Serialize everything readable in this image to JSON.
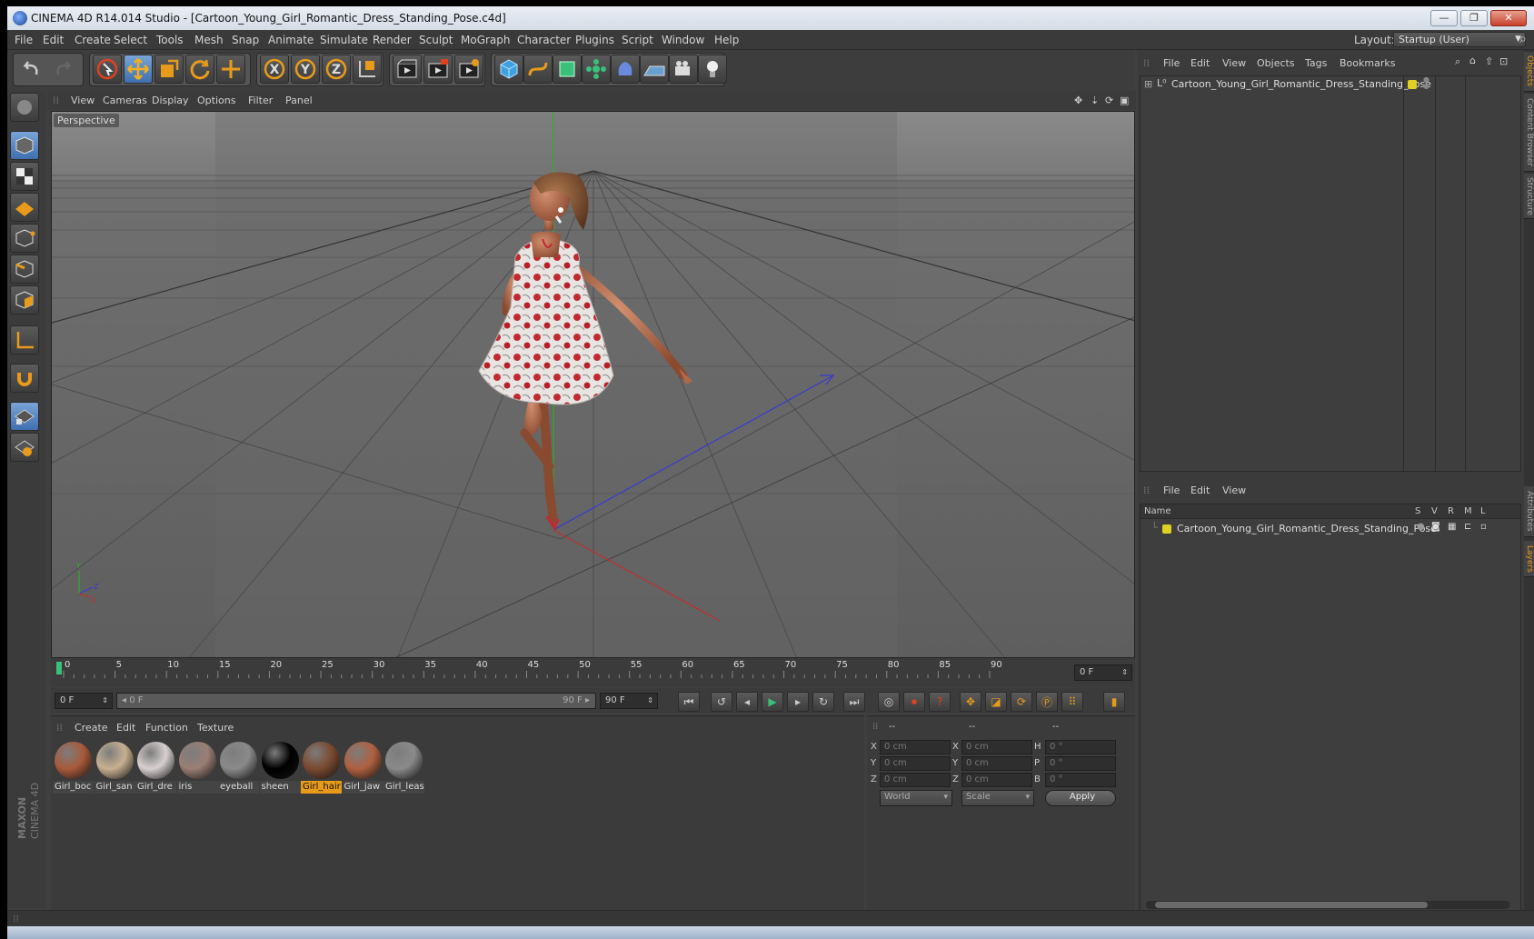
{
  "window": {
    "title": "CINEMA 4D R14.014 Studio - [Cartoon_Young_Girl_Romantic_Dress_Standing_Pose.c4d]",
    "minimize": "—",
    "restore": "❐",
    "close": "✕"
  },
  "menubar": {
    "items": [
      "File",
      "Edit",
      "Create",
      "Select",
      "Tools",
      "Mesh",
      "Snap",
      "Animate",
      "Simulate",
      "Render",
      "Sculpt",
      "MoGraph",
      "Character",
      "Plugins",
      "Script",
      "Window",
      "Help"
    ],
    "layout_label": "Layout:",
    "layout_value": "Startup (User)"
  },
  "viewport": {
    "menu": [
      "View",
      "Cameras",
      "Display",
      "Options",
      "Filter",
      "Panel"
    ],
    "name": "Perspective"
  },
  "timeline": {
    "ticks": [
      "0",
      "5",
      "10",
      "15",
      "20",
      "25",
      "30",
      "35",
      "40",
      "45",
      "50",
      "55",
      "60",
      "65",
      "70",
      "75",
      "80",
      "85",
      "90"
    ],
    "current_frame": "0 F",
    "start_field": "0 F",
    "range_start": "0 F",
    "range_end": "90 F",
    "end_field": "90 F"
  },
  "materials": {
    "menu": [
      "Create",
      "Edit",
      "Function",
      "Texture"
    ],
    "items": [
      {
        "label": "Girl_boc",
        "color": "#a85a3a"
      },
      {
        "label": "Girl_san",
        "color": "#c8b090"
      },
      {
        "label": "Girl_dre",
        "color": "#d8d0d0"
      },
      {
        "label": "iris",
        "color": "#9a7e74"
      },
      {
        "label": "eyeball",
        "color": "#8a8a8a"
      },
      {
        "label": "sheen",
        "color": "#000000"
      },
      {
        "label": "Girl_hair",
        "color": "#7a4a30"
      },
      {
        "label": "Girl_jaw",
        "color": "#b06040"
      },
      {
        "label": "Girl_leas",
        "color": "#8a8a8a"
      }
    ],
    "selected_index": 6
  },
  "coords": {
    "headers": [
      "--",
      "--",
      "--"
    ],
    "rows": [
      {
        "a": "X",
        "av": "0 cm",
        "b": "X",
        "bv": "0 cm",
        "c": "H",
        "cv": "0 °"
      },
      {
        "a": "Y",
        "av": "0 cm",
        "b": "Y",
        "bv": "0 cm",
        "c": "P",
        "cv": "0 °"
      },
      {
        "a": "Z",
        "av": "0 cm",
        "b": "Z",
        "bv": "0 cm",
        "c": "B",
        "cv": "0 °"
      }
    ],
    "mode1": "World",
    "mode2": "Scale",
    "apply": "Apply"
  },
  "objects": {
    "menu": [
      "File",
      "Edit",
      "View",
      "Objects",
      "Tags",
      "Bookmarks"
    ],
    "items": [
      {
        "name": "Cartoon_Young_Girl_Romantic_Dress_Standing_Pose"
      }
    ]
  },
  "layers": {
    "menu": [
      "File",
      "Edit",
      "View"
    ],
    "columns": [
      "Name",
      "S",
      "V",
      "R",
      "M",
      "L"
    ],
    "items": [
      {
        "name": "Cartoon_Young_Girl_Romantic_Dress_Standing_Pose"
      }
    ]
  },
  "side_tabs": [
    "Objects",
    "Content Browser",
    "Structure",
    "Attributes",
    "Layers"
  ],
  "logo": "MAXON CINEMA 4D",
  "colors": {
    "accent": "#e89b1b",
    "select_blue": "#4a79bd",
    "layer_dot": "#e0d020"
  }
}
